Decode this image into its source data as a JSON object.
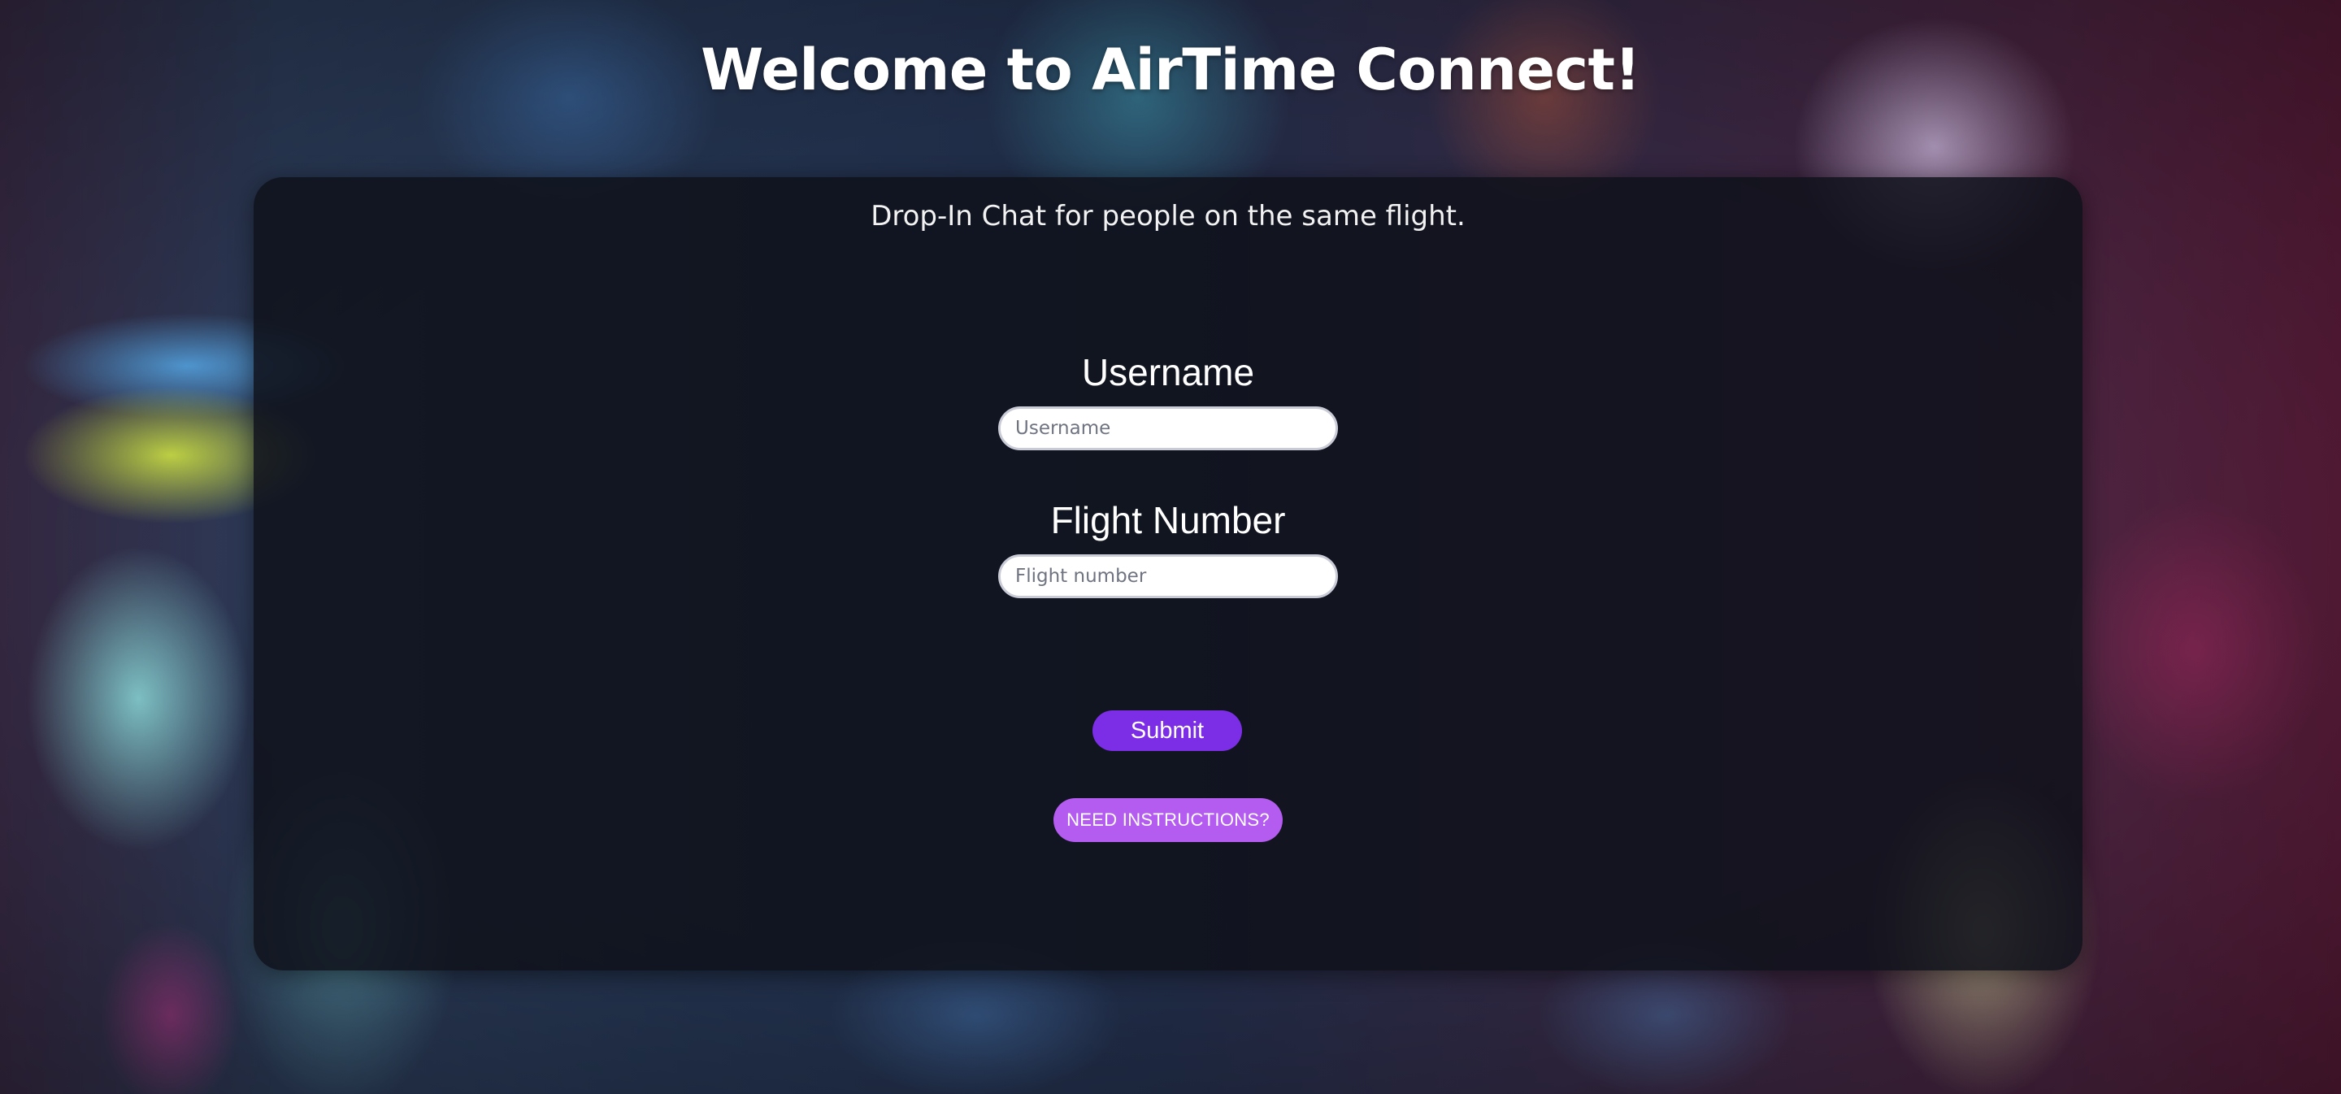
{
  "page": {
    "title": "Welcome to AirTime Connect!",
    "subtitle": "Drop-In Chat for people on the same flight."
  },
  "form": {
    "username": {
      "label": "Username",
      "placeholder": "Username",
      "value": ""
    },
    "flight_number": {
      "label": "Flight Number",
      "placeholder": "Flight number",
      "value": ""
    },
    "submit_label": "Submit",
    "instructions_label": "NEED INSTRUCTIONS?"
  },
  "colors": {
    "submit_button": "#7b2ee6",
    "instructions_button": "#b45bf0",
    "card_background": "#0f111b",
    "text": "#ffffff"
  }
}
